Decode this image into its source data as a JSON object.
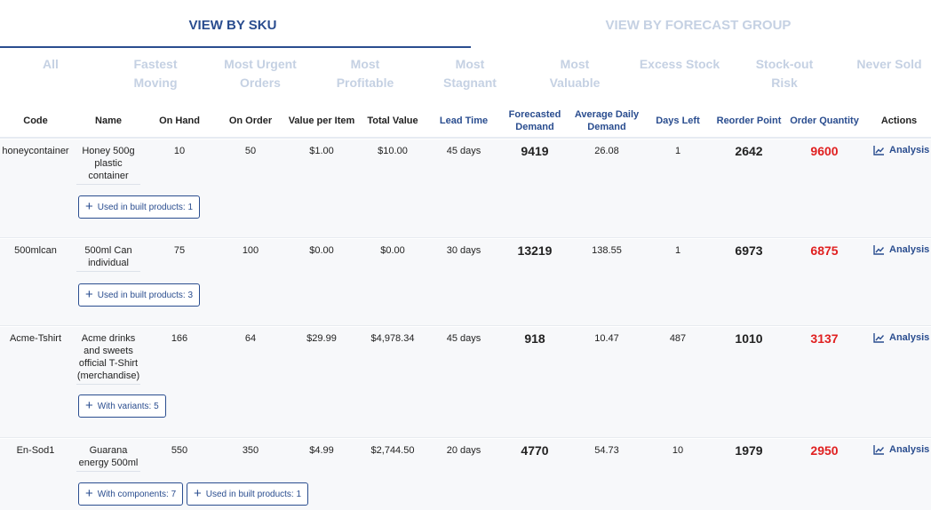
{
  "view_tabs": [
    {
      "label": "VIEW BY SKU",
      "active": true
    },
    {
      "label": "VIEW BY FORECAST GROUP",
      "active": false
    }
  ],
  "filters": [
    {
      "line1": "All",
      "line2": ""
    },
    {
      "line1": "Fastest",
      "line2": "Moving"
    },
    {
      "line1": "Most Urgent",
      "line2": "Orders"
    },
    {
      "line1": "Most",
      "line2": "Profitable"
    },
    {
      "line1": "Most",
      "line2": "Stagnant"
    },
    {
      "line1": "Most",
      "line2": "Valuable"
    },
    {
      "line1": "Excess Stock",
      "line2": ""
    },
    {
      "line1": "Stock-out",
      "line2": "Risk"
    },
    {
      "line1": "Never Sold",
      "line2": ""
    }
  ],
  "columns": {
    "code": "Code",
    "name": "Name",
    "on_hand": "On Hand",
    "on_order": "On Order",
    "value_per_item": "Value per Item",
    "total_value": "Total Value",
    "lead_time": "Lead Time",
    "forecasted_demand_1": "Forecasted",
    "forecasted_demand_2": "Demand",
    "avg_daily_demand_1": "Average Daily",
    "avg_daily_demand_2": "Demand",
    "days_left": "Days Left",
    "reorder_point": "Reorder Point",
    "order_quantity": "Order Quantity",
    "actions": "Actions"
  },
  "analysis_label": "Analysis",
  "rows": [
    {
      "code": "honeycontainer",
      "name_lines": [
        "Honey 500g",
        "plastic",
        "container"
      ],
      "on_hand": "10",
      "on_order": "50",
      "value_per_item": "$1.00",
      "total_value": "$10.00",
      "lead_time": "45 days",
      "forecasted_demand": "9419",
      "avg_daily_demand": "26.08",
      "days_left": "1",
      "reorder_point": "2642",
      "order_quantity": "9600",
      "buttons": [
        "Used in built products: 1"
      ]
    },
    {
      "code": "500mlcan",
      "name_lines": [
        "500ml Can",
        "individual"
      ],
      "on_hand": "75",
      "on_order": "100",
      "value_per_item": "$0.00",
      "total_value": "$0.00",
      "lead_time": "30 days",
      "forecasted_demand": "13219",
      "avg_daily_demand": "138.55",
      "days_left": "1",
      "reorder_point": "6973",
      "order_quantity": "6875",
      "buttons": [
        "Used in built products: 3"
      ]
    },
    {
      "code": "Acme-Tshirt",
      "name_lines": [
        "Acme drinks",
        "and sweets",
        "official T-Shirt",
        "(merchandise)"
      ],
      "on_hand": "166",
      "on_order": "64",
      "value_per_item": "$29.99",
      "total_value": "$4,978.34",
      "lead_time": "45 days",
      "forecasted_demand": "918",
      "avg_daily_demand": "10.47",
      "days_left": "487",
      "reorder_point": "1010",
      "order_quantity": "3137",
      "buttons": [
        "With variants: 5"
      ]
    },
    {
      "code": "En-Sod1",
      "name_lines": [
        "Guarana",
        "energy 500ml"
      ],
      "on_hand": "550",
      "on_order": "350",
      "value_per_item": "$4.99",
      "total_value": "$2,744.50",
      "lead_time": "20 days",
      "forecasted_demand": "4770",
      "avg_daily_demand": "54.73",
      "days_left": "10",
      "reorder_point": "1979",
      "order_quantity": "2950",
      "buttons": [
        "With components: 7",
        "Used in built products: 1"
      ]
    }
  ]
}
